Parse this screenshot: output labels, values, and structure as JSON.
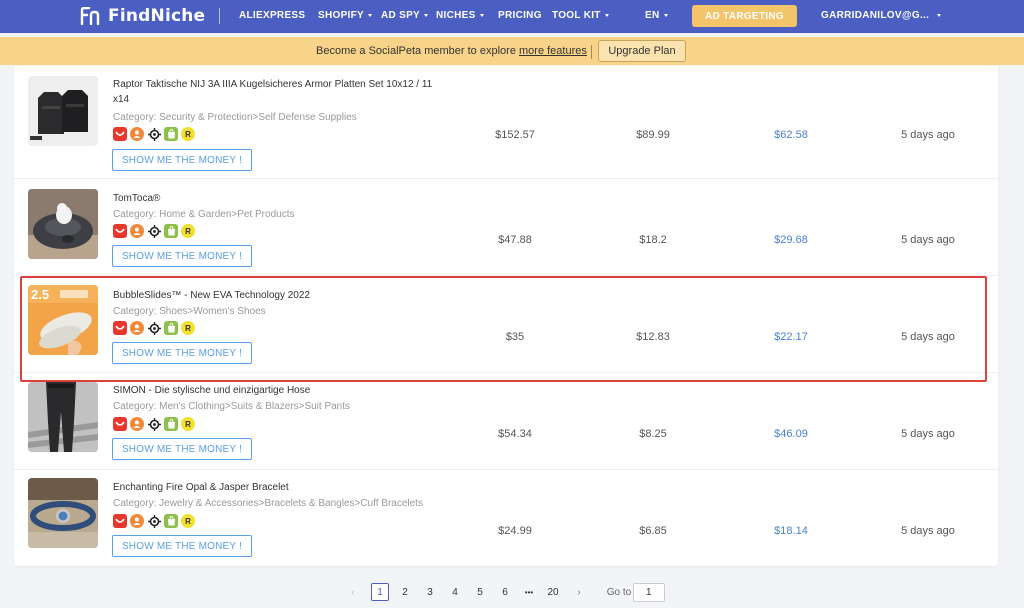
{
  "nav": {
    "logo": "FindNiche",
    "items": [
      "ALIEXPRESS",
      "SHOPIFY",
      "AD SPY",
      "NICHES",
      "PRICING",
      "TOOL KIT",
      "EN"
    ],
    "ad_targeting": "AD TARGETING",
    "user": "GARRIDANILOV@G..."
  },
  "banner": {
    "text_before": "Become a SocialPeta member to explore ",
    "link": "more features",
    "button": "Upgrade Plan"
  },
  "rows": [
    {
      "title": "Raptor Taktische NIJ 3A IIIA Kugelsicheres Armor Platten Set 10x12 / 11 x14",
      "category": "Category: Security & Protection>Self Defense Supplies",
      "button": "SHOW ME THE MONEY !",
      "price": "$152.57",
      "cost": "$89.99",
      "profit": "$62.58",
      "time": "5 days ago"
    },
    {
      "title": "TomToca®",
      "category": "Category: Home & Garden>Pet Products",
      "button": "SHOW ME THE MONEY !",
      "price": "$47.88",
      "cost": "$18.2",
      "profit": "$29.68",
      "time": "5 days ago"
    },
    {
      "title": "BubbleSlides™ - New EVA Technology 2022",
      "category": "Category: Shoes>Women's Shoes",
      "button": "SHOW ME THE MONEY !",
      "price": "$35",
      "cost": "$12.83",
      "profit": "$22.17",
      "time": "5 days ago",
      "thumb_text": "2.5"
    },
    {
      "title": "SIMON - Die stylische und einzigartige Hose",
      "category": "Category: Men's Clothing>Suits & Blazers>Suit Pants",
      "button": "SHOW ME THE MONEY !",
      "price": "$54.34",
      "cost": "$8.25",
      "profit": "$46.09",
      "time": "5 days ago"
    },
    {
      "title": "Enchanting Fire Opal & Jasper Bracelet",
      "category": "Category: Jewelry & Accessories>Bracelets & Bangles>Cuff Bracelets",
      "button": "SHOW ME THE MONEY !",
      "price": "$24.99",
      "cost": "$6.85",
      "profit": "$18.14",
      "time": "5 days ago"
    }
  ],
  "pagination": {
    "prev": "‹",
    "pages": [
      "1",
      "2",
      "3",
      "4",
      "5",
      "6"
    ],
    "ellipsis": "•••",
    "last": "20",
    "next": "›",
    "goto_label": "Go to",
    "goto_value": "1",
    "current": "1"
  },
  "colors": {
    "nav_bg": "#4a5fc1",
    "banner_bg": "#f8d48a",
    "ad_button": "#f4c46a",
    "profit_blue": "#4a7fd6",
    "highlight_red": "#e0403c",
    "button_blue": "#5aa0e8"
  }
}
